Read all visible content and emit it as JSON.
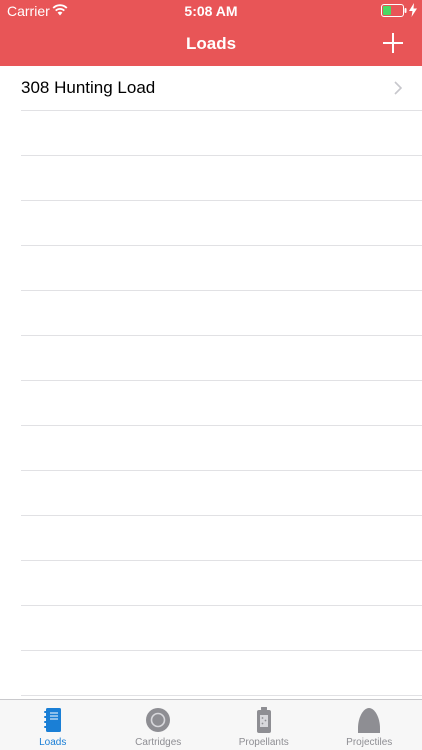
{
  "status_bar": {
    "carrier": "Carrier",
    "time": "5:08 AM"
  },
  "nav": {
    "title": "Loads",
    "add_label": "+"
  },
  "list": {
    "items": [
      {
        "label": "308 Hunting Load"
      }
    ]
  },
  "tab_bar": {
    "tabs": [
      {
        "label": "Loads",
        "icon": "notebook-icon",
        "active": true
      },
      {
        "label": "Cartridges",
        "icon": "cartridge-icon",
        "active": false
      },
      {
        "label": "Propellants",
        "icon": "propellant-icon",
        "active": false
      },
      {
        "label": "Projectiles",
        "icon": "projectile-icon",
        "active": false
      }
    ]
  },
  "colors": {
    "header": "#e85557",
    "active_tab": "#1a7fd6",
    "inactive_tab": "#8e8e93"
  }
}
